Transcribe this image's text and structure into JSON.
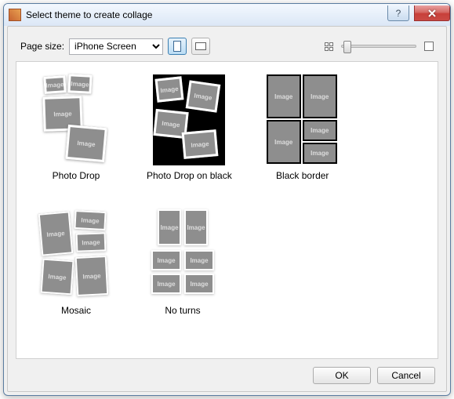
{
  "window": {
    "title": "Select theme to create collage"
  },
  "toolbar": {
    "page_size_label": "Page size:",
    "page_size_value": "iPhone Screen"
  },
  "themes": [
    {
      "label": "Photo Drop"
    },
    {
      "label": "Photo Drop on black"
    },
    {
      "label": "Black border"
    },
    {
      "label": "Mosaic"
    },
    {
      "label": "No turns"
    }
  ],
  "placeholder_text": "Image",
  "footer": {
    "ok": "OK",
    "cancel": "Cancel"
  }
}
